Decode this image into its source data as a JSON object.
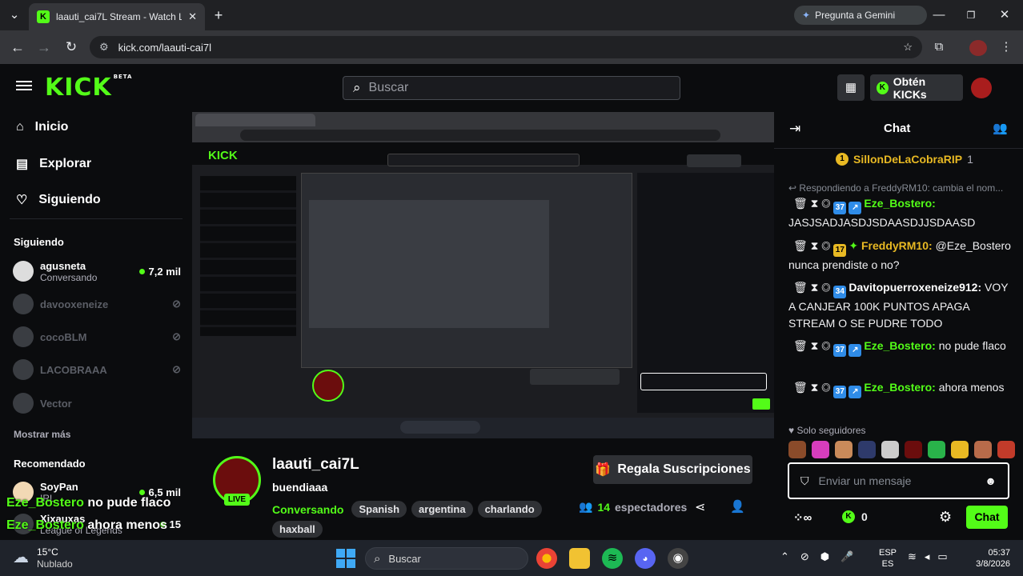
{
  "browser": {
    "tab_title": "laauti_cai7L Stream - Watch Liv",
    "url": "kick.com/laauti-cai7l",
    "gemini_label": "Pregunta a Gemini"
  },
  "header": {
    "logo": "KICK",
    "logo_badge": "BETA",
    "search_placeholder": "Buscar",
    "get_kicks_label": "Obtén KICKs"
  },
  "sidebar": {
    "nav": [
      {
        "label": "Inicio"
      },
      {
        "label": "Explorar"
      },
      {
        "label": "Siguiendo"
      }
    ],
    "following_title": "Siguiendo",
    "following": [
      {
        "name": "agusneta",
        "status": "Conversando",
        "viewers": "7,2 mil",
        "live": true
      },
      {
        "name": "davooxeneize",
        "live": false
      },
      {
        "name": "cocoBLM",
        "live": false
      },
      {
        "name": "LACOBRAAA",
        "live": false
      },
      {
        "name": "Vector",
        "live": false
      }
    ],
    "show_more": "Mostrar más",
    "recommended_title": "Recomendado",
    "recommended": [
      {
        "name": "SoyPan",
        "status": "IRL",
        "viewers": "6,5 mil"
      },
      {
        "name": "Xixauxas",
        "status": "League of Legends",
        "viewers": "15"
      }
    ],
    "overlay_lines": [
      {
        "user": "Eze_Bostero",
        "text": "no pude flaco"
      },
      {
        "user": "Eze_Bostero",
        "text": "ahora menos"
      }
    ]
  },
  "stream": {
    "channel_name": "laauti_cai7L",
    "title": "buendiaaa",
    "category": "Conversando",
    "tags": [
      "Spanish",
      "argentina",
      "charlando",
      "haxball"
    ],
    "viewers_count": "14",
    "viewers_label": "espectadores",
    "live_badge": "LIVE",
    "gift_button": "Regala Suscripciones"
  },
  "chat": {
    "title": "Chat",
    "pinned_user": "SillonDeLaCobraRIP",
    "pinned_count": "1",
    "reply_notice": "Respondiendo a FreddyRM10: cambia el nom...",
    "messages": [
      {
        "user": "Eze_Bostero",
        "badge": "37",
        "text": "JASJSADJASDJSDAASDJJSDAASD"
      },
      {
        "user": "FreddyRM10",
        "badge": "17",
        "text": "@Eze_Bostero nunca prendiste o no?"
      },
      {
        "user": "Davitopuerroxeneize912",
        "badge": "34",
        "text": "VOY A CANJEAR 100K PUNTOS APAGA STREAM O SE PUDRE TODO"
      },
      {
        "user": "Eze_Bostero",
        "badge": "37",
        "text": "no pude flaco"
      },
      {
        "user": "Eze_Bostero",
        "badge": "37",
        "text": "ahora menos"
      }
    ],
    "followers_only": "Solo seguidores",
    "input_placeholder": "Enviar un mensaje",
    "points": "0",
    "send_label": "Chat"
  },
  "taskbar": {
    "weather_temp": "15°C",
    "weather_desc": "Nublado",
    "search_placeholder": "Buscar",
    "lang_top": "ESP",
    "lang_bottom": "ES",
    "time": "05:37",
    "date": "3/8/2026"
  }
}
